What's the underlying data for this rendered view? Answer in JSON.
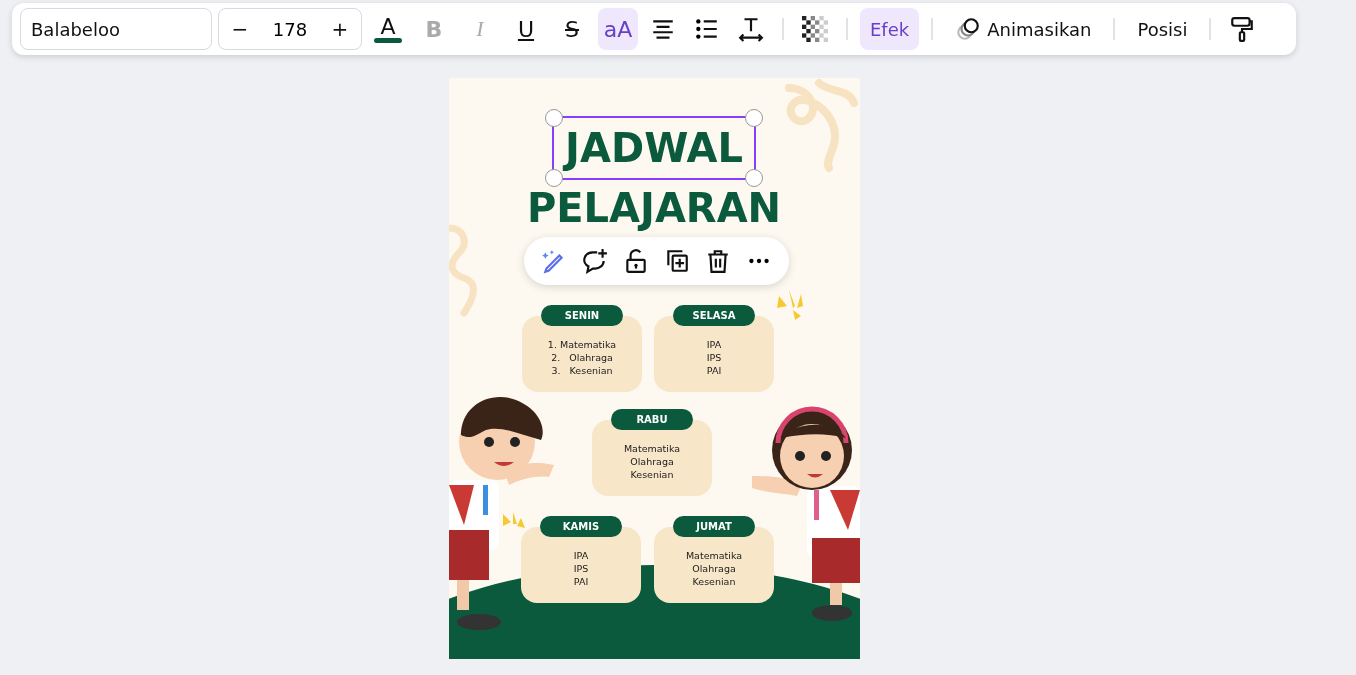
{
  "toolbar": {
    "font": {
      "value": "Balabeloo"
    },
    "font_size": {
      "decrease": "−",
      "value": "178",
      "increase": "+"
    },
    "text_color": {
      "label": "A",
      "color": "#0b5a3e"
    },
    "format_buttons": [
      {
        "kind": "bold",
        "label": "B",
        "disabled": true,
        "selected": false
      },
      {
        "kind": "italic",
        "label": "I",
        "disabled": true,
        "selected": false
      },
      {
        "kind": "underline",
        "label": "U",
        "disabled": false,
        "selected": false
      },
      {
        "kind": "strike",
        "label": "S",
        "disabled": false,
        "selected": false
      },
      {
        "kind": "case",
        "label": "aA",
        "disabled": false,
        "selected": true
      }
    ],
    "effects": {
      "label": "Efek",
      "selected": true
    },
    "animate": {
      "label": "Animasikan"
    },
    "position": {
      "label": "Posisi"
    }
  },
  "design": {
    "title": [
      "JADWAL",
      "PELAJARAN"
    ],
    "title_selected": true,
    "days": [
      {
        "name": "SENIN",
        "items": [
          "1. Matematika",
          "2.   Olahraga",
          "3.   Kesenian"
        ]
      },
      {
        "name": "SELASA",
        "items": [
          "IPA",
          "IPS",
          "PAI"
        ]
      },
      {
        "name": "RABU",
        "items": [
          "Matematika",
          "Olahraga",
          "Kesenian"
        ]
      },
      {
        "name": "KAMIS",
        "items": [
          "IPA",
          "IPS",
          "PAI"
        ]
      },
      {
        "name": "JUMAT",
        "items": [
          "Matematika",
          "Olahraga",
          "Kesenian"
        ]
      }
    ]
  }
}
